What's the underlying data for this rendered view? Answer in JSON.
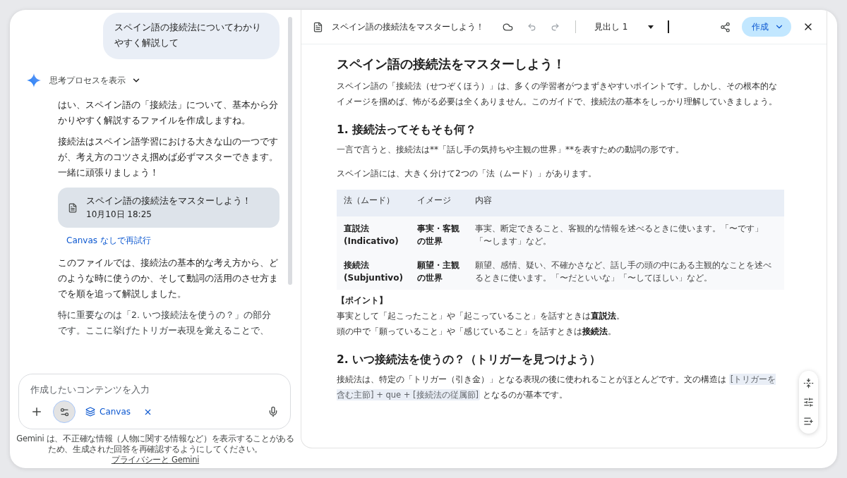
{
  "chat": {
    "user_message": "スペイン語の接続法についてわかりやすく解説して",
    "thinking_toggle": {
      "label": "思考プロセスを表示",
      "expanded": false
    },
    "response_before": [
      "はい、スペイン語の「接続法」について、基本から分かりやすく解説するファイルを作成しますね。",
      "接続法はスペイン語学習における大きな山の一つですが、考え方のコツさえ掴めば必ずマスターできます。一緒に頑張りましょう！"
    ],
    "file_card": {
      "title": "スペイン語の接続法をマスターしよう！",
      "date": "10月10日 18:25"
    },
    "retry_link": "Canvas なしで再試行",
    "response_after": [
      "このファイルでは、接続法の基本的な考え方から、どのような時に使うのか、そして動詞の活用のさせ方までを順を追って解説しました。",
      "特に重要なのは「2. いつ接続法を使うの？」の部分です。ここに挙げたトリガー表現を覚えることで、"
    ],
    "input": {
      "placeholder": "作成したいコンテンツを入力"
    },
    "tool_chip": "Canvas",
    "disclaimer": {
      "text": "Gemini は、不正確な情報（人物に関する情報など）を表示することがあるため、生成された回答を再確認するようにしてください。",
      "link": "プライバシーと Gemini"
    }
  },
  "canvas": {
    "toolbar": {
      "doc_title": "スペイン語の接続法をマスターしよう！",
      "style_select": "見出し 1",
      "create_button": "作成"
    },
    "blocks": [
      {
        "kind": "title",
        "text": "スペイン語の接続法をマスターしよう！"
      },
      {
        "kind": "paragraph",
        "text": "スペイン語の「接続法（せつぞくほう）」は、多くの学習者がつまずきやすいポイントです。しかし、その根本的なイメージを掴めば、怖がる必要は全くありません。このガイドで、接続法の基本をしっかり理解していきましょう。"
      },
      {
        "kind": "heading",
        "text": "1. 接続法ってそもそも何？"
      },
      {
        "kind": "paragraph",
        "text": "一言で言うと、接続法は**「話し手の気持ちや主観の世界」**を表すための動詞の形です。"
      },
      {
        "kind": "paragraph",
        "text": "スペイン語には、大きく分けて2つの「法（ムード）」があります。"
      },
      {
        "kind": "table",
        "columns": [
          "法（ムード）",
          "イメージ",
          "内容"
        ],
        "rows": [
          [
            "直説法\n(Indicativo)",
            "事実・客観の世界",
            "事実、断定できること、客観的な情報を述べるときに使います。「〜です」「〜します」など。"
          ],
          [
            "接続法\n(Subjuntivo)",
            "願望・主観の世界",
            "願望、感情、疑い、不確かさなど、話し手の頭の中にある主観的なことを述べるときに使います。「〜だといいな」「〜してほしい」など。"
          ]
        ]
      },
      {
        "kind": "label",
        "text": "【ポイント】"
      },
      {
        "kind": "line",
        "text": "事実として「起こったこと」や「起こっていること」を話すときは**直説法**。"
      },
      {
        "kind": "line",
        "text": "頭の中で「願っていること」や「感じていること」を話すときは**接続法**。"
      },
      {
        "kind": "heading",
        "text": "2. いつ接続法を使うの？（トリガーを見つけよう）"
      },
      {
        "kind": "mixed",
        "parts": [
          {
            "kind": "text",
            "text": "接続法は、特定の「トリガー（引き金）」となる表現の後に使われることがほとんどです。文の構造は "
          },
          {
            "kind": "code",
            "text": "[トリガーを含む主節] + que + [接続法の従属節]"
          },
          {
            "kind": "text",
            "text": " となるのが基本です。"
          }
        ]
      }
    ]
  }
}
